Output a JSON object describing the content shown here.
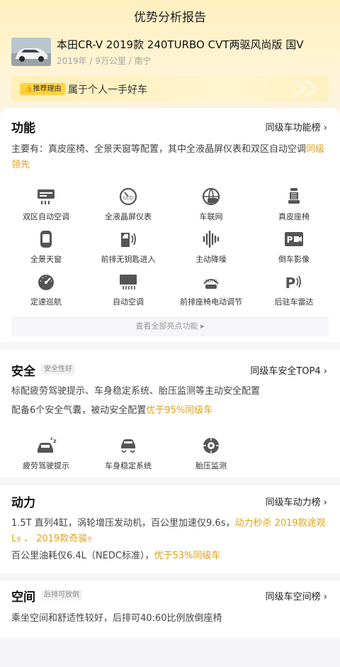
{
  "page": {
    "title": "优势分析报告"
  },
  "car": {
    "name": "本田CR-V 2019款 240TURBO CVT两驱风尚版 国V",
    "meta": "2019年 / 9万公里 / 南宁"
  },
  "reason": {
    "badge": "推荐理由",
    "text": "属于个人一手好车"
  },
  "function": {
    "title": "功能",
    "link": "同级车功能榜",
    "desc_main": "主要有：真皮座椅、全景天窗等配置，其中全液晶屏仪表和双区自动空调",
    "desc_highlight": "同级领先",
    "features": [
      {
        "label": "双区自动空调",
        "icon": "dual-zone-ac-icon"
      },
      {
        "label": "全液晶屏仪表",
        "icon": "lcd-dashboard-icon"
      },
      {
        "label": "车联网",
        "icon": "connected-car-icon"
      },
      {
        "label": "真皮座椅",
        "icon": "leather-seat-icon"
      },
      {
        "label": "全景天窗",
        "icon": "panoramic-sunroof-icon"
      },
      {
        "label": "前排无钥匙进入",
        "icon": "keyless-entry-icon"
      },
      {
        "label": "主动降噪",
        "icon": "noise-cancel-icon"
      },
      {
        "label": "倒车影像",
        "icon": "reverse-camera-icon"
      },
      {
        "label": "定速巡航",
        "icon": "cruise-control-icon"
      },
      {
        "label": "自动空调",
        "icon": "auto-ac-icon"
      },
      {
        "label": "前排座椅电动调节",
        "icon": "power-seat-icon"
      },
      {
        "label": "后驻车雷达",
        "icon": "parking-radar-icon"
      }
    ],
    "view_all": "查看全部亮点功能 ▸"
  },
  "safety": {
    "title": "安全",
    "tag": "安全性好",
    "link": "同级车安全TOP4",
    "desc1": "标配疲劳驾驶提示、车身稳定系统、胎压监测等主动安全配置",
    "desc2_main": "配备6个安全气囊，被动安全配置",
    "desc2_highlight": "优于95%同级车",
    "features": [
      {
        "label": "疲劳驾驶提示",
        "icon": "fatigue-alert-icon"
      },
      {
        "label": "车身稳定系统",
        "icon": "stability-control-icon"
      },
      {
        "label": "胎压监测",
        "icon": "tire-pressure-icon"
      }
    ]
  },
  "power": {
    "title": "动力",
    "link": "同级车动力榜",
    "desc1_main": "1.5T 直列4缸，涡轮增压发动机，百公里加速仅9.6s，",
    "desc1_highlight_a": "动力秒杀 2019款途观L",
    "desc1_sep": " 、 ",
    "desc1_highlight_b": "2019款奇骏",
    "desc2_main": "百公里油耗仅6.4L（NEDC标准），",
    "desc2_highlight": "优于53%同级车"
  },
  "space": {
    "title": "空间",
    "tag": "后排可放倒",
    "link": "同级车空间榜",
    "desc": "乘坐空间和舒适性较好，后排可40:60比例放倒座椅"
  },
  "colors": {
    "accent": "#e0a21a",
    "badge": "#ffd23d",
    "icon": "#555555"
  }
}
